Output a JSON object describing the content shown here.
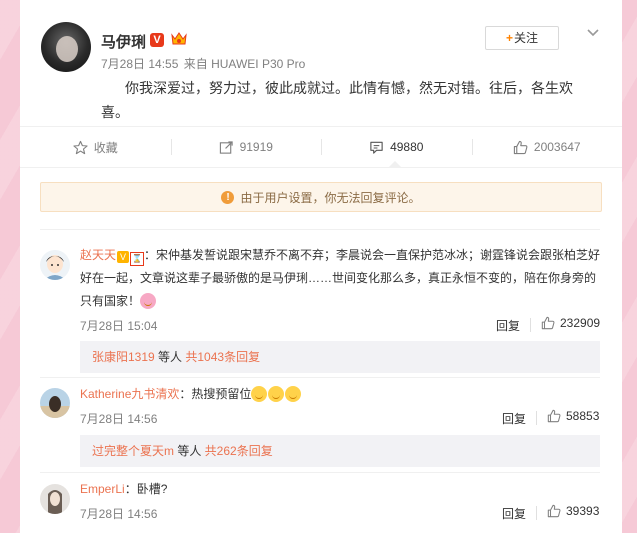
{
  "post": {
    "author": "马伊琍",
    "time": "7月28日 14:55",
    "source": "来自 HUAWEI P30 Pro",
    "follow_label": "+关注",
    "text": "你我深爱过，努力过，彼此成就过。此情有憾，然无对错。往后，各生欢喜。"
  },
  "actions": [
    {
      "icon": "star-icon",
      "label": "收藏"
    },
    {
      "icon": "share-icon",
      "label": "91919"
    },
    {
      "icon": "comment-icon",
      "label": "49880"
    },
    {
      "icon": "like-icon",
      "label": "2003647"
    }
  ],
  "notice": "由于用户设置，你无法回复评论。",
  "comments": [
    {
      "user": "赵天天",
      "text": "：宋仲基发誓说跟宋慧乔不离不弃；李晨说会一直保护范冰冰；谢霆锋说会跟张柏芝好好在一起，文章说这辈子最骄傲的是马伊琍……世间变化那么多，真正永恒不变的，陪在你身旁的只有国家！",
      "time": "7月28日 15:04",
      "reply_label": "回复",
      "likes": "232909",
      "sub_user": "张康阳1319",
      "sub_mid": " 等人 ",
      "sub_count": "共1043条回复"
    },
    {
      "user": "Katherine九书清欢",
      "text": "：热搜预留位",
      "time": "7月28日 14:56",
      "reply_label": "回复",
      "likes": "58853",
      "sub_user": "过完整个夏天m",
      "sub_mid": " 等人 ",
      "sub_count": "共262条回复"
    },
    {
      "user": "EmperLi",
      "text": "：卧槽?",
      "time": "7月28日 14:56",
      "reply_label": "回复",
      "likes": "39393"
    }
  ],
  "colors": {
    "accent_orange": "#ff8200",
    "username": "#eb7350",
    "verified_red": "#e8391a",
    "background_pink": "#f6c9d6"
  }
}
